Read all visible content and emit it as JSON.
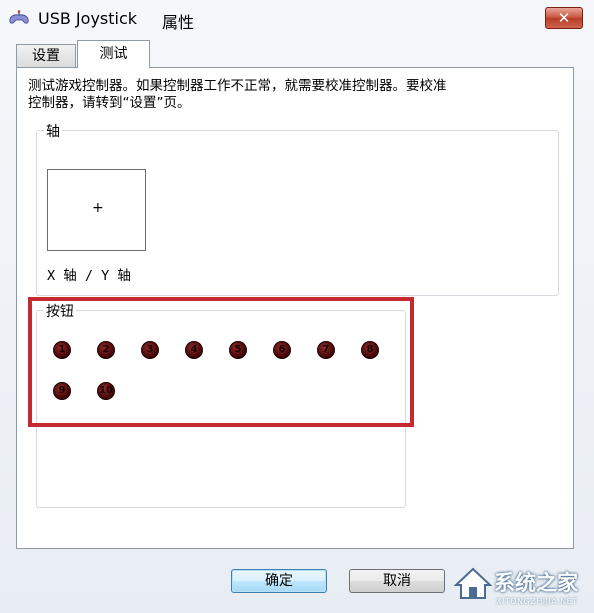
{
  "window": {
    "title": "USB Joystick",
    "title_suffix": "属性",
    "close_label": "✕"
  },
  "tabs": [
    {
      "label": "设置",
      "selected": false
    },
    {
      "label": "测试",
      "selected": true
    }
  ],
  "description": {
    "line1": "测试游戏控制器。如果控制器工作不正常，就需要校准控制器。要校准",
    "line2": "控制器，请转到“设置”页。"
  },
  "axis_group": {
    "label": "轴",
    "crosshair": "+",
    "caption": "X 轴 / Y 轴"
  },
  "buttons_group": {
    "label": "按钮",
    "buttons": [
      "1",
      "2",
      "3",
      "4",
      "5",
      "6",
      "7",
      "8",
      "9",
      "10"
    ]
  },
  "dialog_buttons": {
    "ok": "确定",
    "cancel": "取消"
  },
  "watermark": {
    "text": "系统之家",
    "sub": "XITONGZHIJIA.NET"
  },
  "colors": {
    "highlight": "#c42a2f",
    "button_dot": "#5a0c0c"
  }
}
